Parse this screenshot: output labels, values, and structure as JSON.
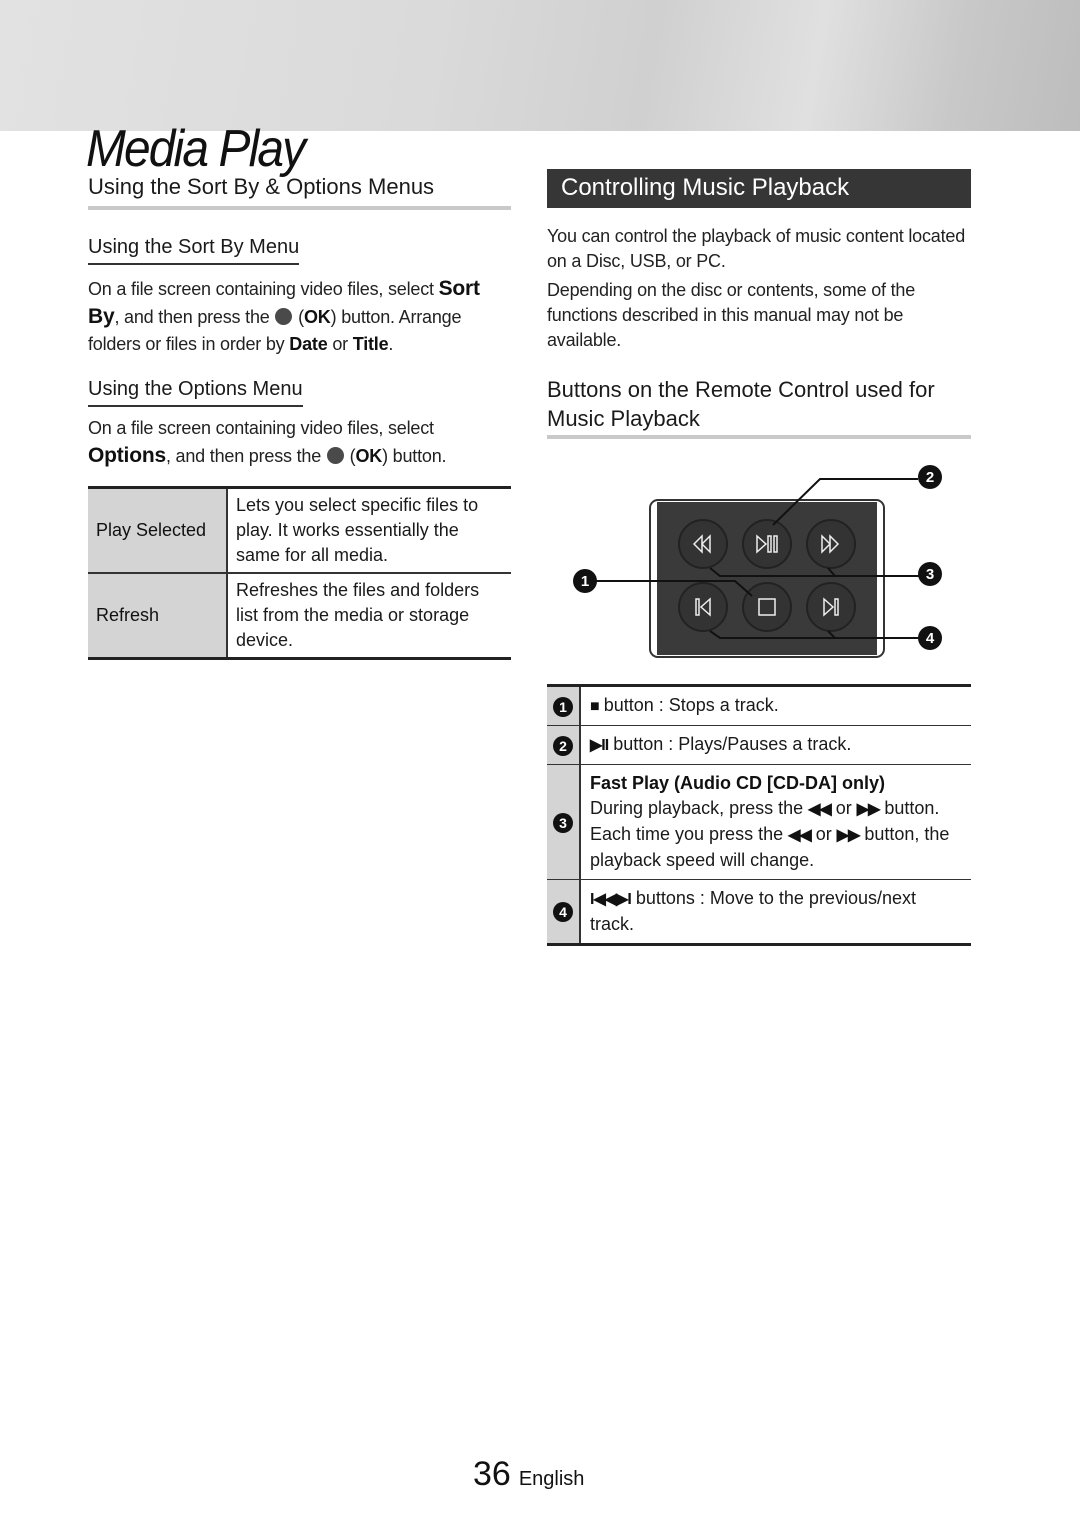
{
  "header": {
    "title": "Media Play"
  },
  "left": {
    "section_title": "Using the Sort By & Options Menus",
    "sort_by": {
      "title": "Using the Sort By Menu",
      "text_1": "On a file screen containing video files, select ",
      "bold_1": "Sort By",
      "text_2": ", and then press the ",
      "ok_label": "OK",
      "text_3": " button. Arrange folders or files in order by ",
      "bold_date": "Date",
      "text_or": " or ",
      "bold_title": "Title",
      "text_end": "."
    },
    "options": {
      "title": "Using the Options Menu",
      "text_1": "On a file screen containing video files, select ",
      "bold_1": "Options",
      "text_2": ", and then press the ",
      "ok_label": "OK",
      "text_3": " button."
    },
    "options_table": [
      {
        "option": "Play Selected",
        "description": "Lets you select specific files to play. It works essentially the same for all media."
      },
      {
        "option": "Refresh",
        "description": "Refreshes the files and folders list from the media or storage device."
      }
    ]
  },
  "right": {
    "section_title": "Controlling Music Playback",
    "para_1": "You can control the playback of music content located on a Disc, USB, or PC.",
    "para_2": "Depending on the disc or contents, some of the functions described in this manual may not be available.",
    "buttons_title": "Buttons on the Remote Control used for Music Playback",
    "remote_buttons": [
      "rewind",
      "play-pause",
      "fast-forward",
      "previous",
      "stop",
      "next"
    ],
    "callouts": [
      "1",
      "2",
      "3",
      "4"
    ],
    "table": [
      {
        "num": "1",
        "symbol": "■",
        "text": "button : Stops a track."
      },
      {
        "num": "2",
        "symbol": "▶II",
        "text": "button : Plays/Pauses a track."
      },
      {
        "num": "3",
        "heading": "Fast Play (Audio CD [CD-DA] only)",
        "line_1a": "During playback, press the ",
        "sym_rew": "◀◀",
        "or": " or ",
        "sym_ff": "▶▶",
        "line_1b": " button.",
        "line_2a": "Each time you press the ",
        "line_2b": " button, the playback speed will change."
      },
      {
        "num": "4",
        "symbol": "I◀◀▶I",
        "text": "buttons : Move to the previous/next track."
      }
    ]
  },
  "footer": {
    "page_number": "36",
    "language": "English"
  }
}
